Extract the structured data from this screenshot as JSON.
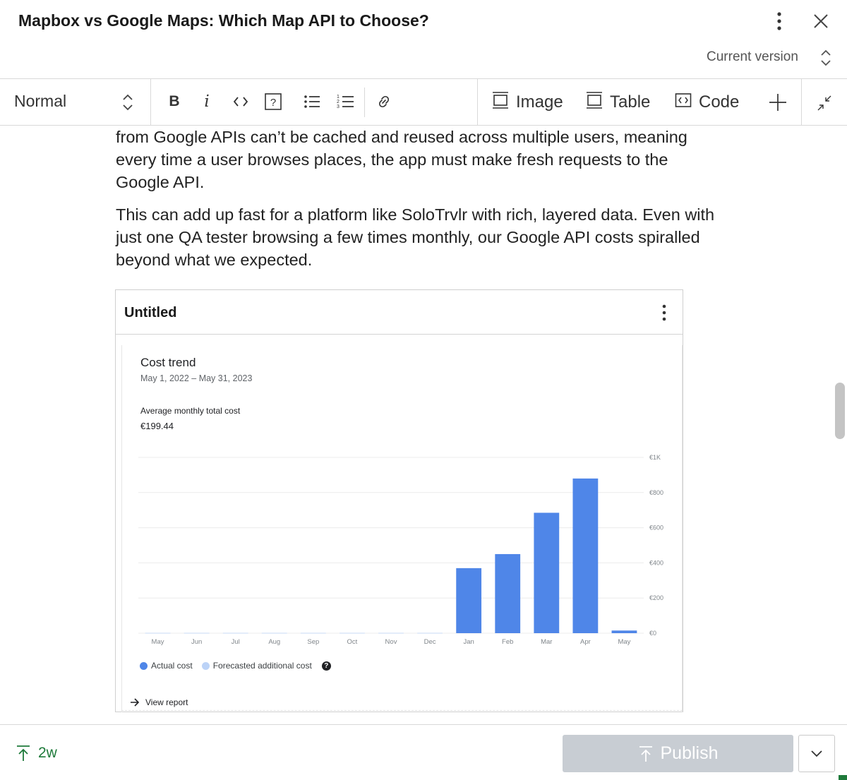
{
  "header": {
    "title": "Mapbox vs Google Maps: Which Map API to Choose?",
    "version_label": "Current version",
    "more_icon": "more-vertical-icon",
    "close_icon": "close-icon"
  },
  "toolbar": {
    "style_value": "Normal",
    "buttons": [
      "bold",
      "italic",
      "inline-code",
      "help",
      "bulleted-list",
      "numbered-list",
      "link"
    ],
    "insert": {
      "image": "Image",
      "table": "Table",
      "code": "Code"
    }
  },
  "body": {
    "para1": "from Google APIs can’t be cached and reused across multiple users, meaning every time a user browses places, the app must make fresh requests to the Google API.",
    "para2": "This can add up fast for a platform like SoloTrvlr with rich, layered data. Even with just one QA tester browsing a few times monthly, our Google API costs spiralled beyond what we expected."
  },
  "embed": {
    "title": "Untitled",
    "card_title": "Cost trend",
    "date_range": "May 1, 2022 – May 31, 2023",
    "avg_label": "Average monthly total cost",
    "avg_value": "€199.44",
    "view_report": "View report"
  },
  "chart_data": {
    "type": "bar",
    "title": "Cost trend",
    "categories": [
      "May",
      "Jun",
      "Jul",
      "Aug",
      "Sep",
      "Oct",
      "Nov",
      "Dec",
      "Jan",
      "Feb",
      "Mar",
      "Apr",
      "May"
    ],
    "series": [
      {
        "name": "Actual cost",
        "color": "#4f86e8",
        "values": [
          2,
          2,
          2,
          2,
          2,
          2,
          2,
          2,
          370,
          450,
          685,
          880,
          15
        ]
      },
      {
        "name": "Forecasted additional cost",
        "color": "#bcd3f7",
        "values": [
          0,
          0,
          0,
          0,
          0,
          0,
          0,
          0,
          0,
          0,
          0,
          0,
          0
        ]
      }
    ],
    "y_ticks": [
      "€0",
      "€200",
      "€400",
      "€600",
      "€800",
      "€1K"
    ],
    "ylim": [
      0,
      1000
    ],
    "y_axis_side": "right",
    "grid": true,
    "legend_position": "bottom-left"
  },
  "footer": {
    "time_label": "2w",
    "publish_label": "Publish"
  }
}
